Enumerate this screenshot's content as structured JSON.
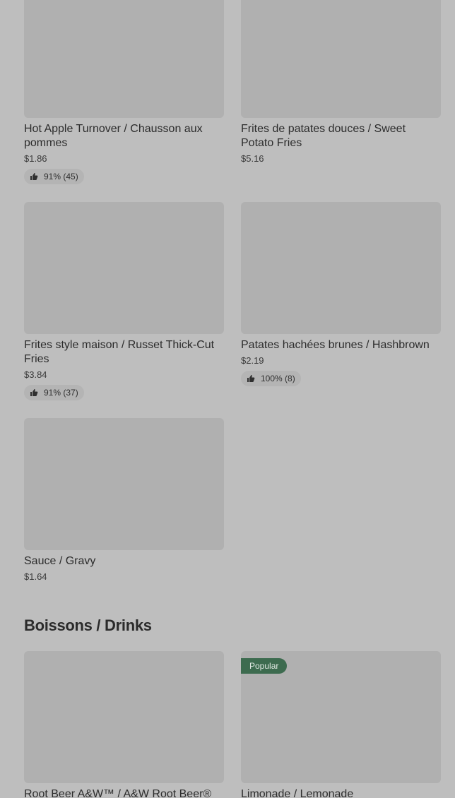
{
  "items_top": [
    {
      "name": "Hot Apple Turnover / Chausson aux pommes",
      "price": "$1.86",
      "rating": "91% (45)"
    },
    {
      "name": "Frites de patates douces / Sweet Potato Fries",
      "price": "$5.16"
    },
    {
      "name": "Frites style maison / Russet Thick-Cut Fries",
      "price": "$3.84",
      "rating": "91% (37)"
    },
    {
      "name": "Patates hachées brunes / Hashbrown",
      "price": "$2.19",
      "rating": "100% (8)"
    },
    {
      "name": "Sauce / Gravy",
      "price": "$1.64"
    }
  ],
  "drinks_section": {
    "title": "Boissons / Drinks",
    "items": [
      {
        "name": "Root Beer A&W™ / A&W Root Beer®"
      },
      {
        "name": "Limonade / Lemonade",
        "badge": "Popular"
      }
    ]
  },
  "icons": {
    "rating": "thumbs-up-icon"
  },
  "colors": {
    "background": "#bebebe",
    "image_placeholder": "#b0b0b0",
    "badge": "#3d6b4f"
  }
}
